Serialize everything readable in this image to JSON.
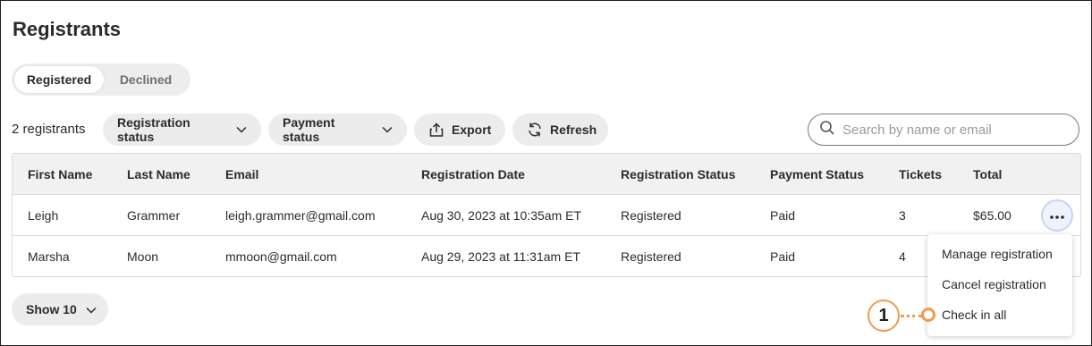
{
  "page": {
    "title": "Registrants"
  },
  "tabs": {
    "registered": "Registered",
    "declined": "Declined"
  },
  "toolbar": {
    "count": "2 registrants",
    "registration_status": "Registration status",
    "payment_status": "Payment status",
    "export": "Export",
    "refresh": "Refresh",
    "search_placeholder": "Search by name or email"
  },
  "table": {
    "headers": {
      "first_name": "First Name",
      "last_name": "Last Name",
      "email": "Email",
      "registration_date": "Registration Date",
      "registration_status": "Registration Status",
      "payment_status": "Payment Status",
      "tickets": "Tickets",
      "total": "Total"
    },
    "rows": [
      {
        "first_name": "Leigh",
        "last_name": "Grammer",
        "email": "leigh.grammer@gmail.com",
        "registration_date": "Aug 30, 2023 at 10:35am ET",
        "registration_status": "Registered",
        "payment_status": "Paid",
        "tickets": "3",
        "total": "$65.00"
      },
      {
        "first_name": "Marsha",
        "last_name": "Moon",
        "email": "mmoon@gmail.com",
        "registration_date": "Aug 29, 2023 at 11:31am ET",
        "registration_status": "Registered",
        "payment_status": "Paid",
        "tickets": "4",
        "total": ""
      }
    ]
  },
  "row_menu": {
    "manage": "Manage registration",
    "cancel": "Cancel registration",
    "check_in": "Check in all"
  },
  "pagination": {
    "show": "Show 10"
  },
  "callout": {
    "number": "1"
  },
  "colors": {
    "callout_orange": "#f29a4a",
    "more_button_ring": "#c5d4f6",
    "pill_bg": "#ececec"
  }
}
